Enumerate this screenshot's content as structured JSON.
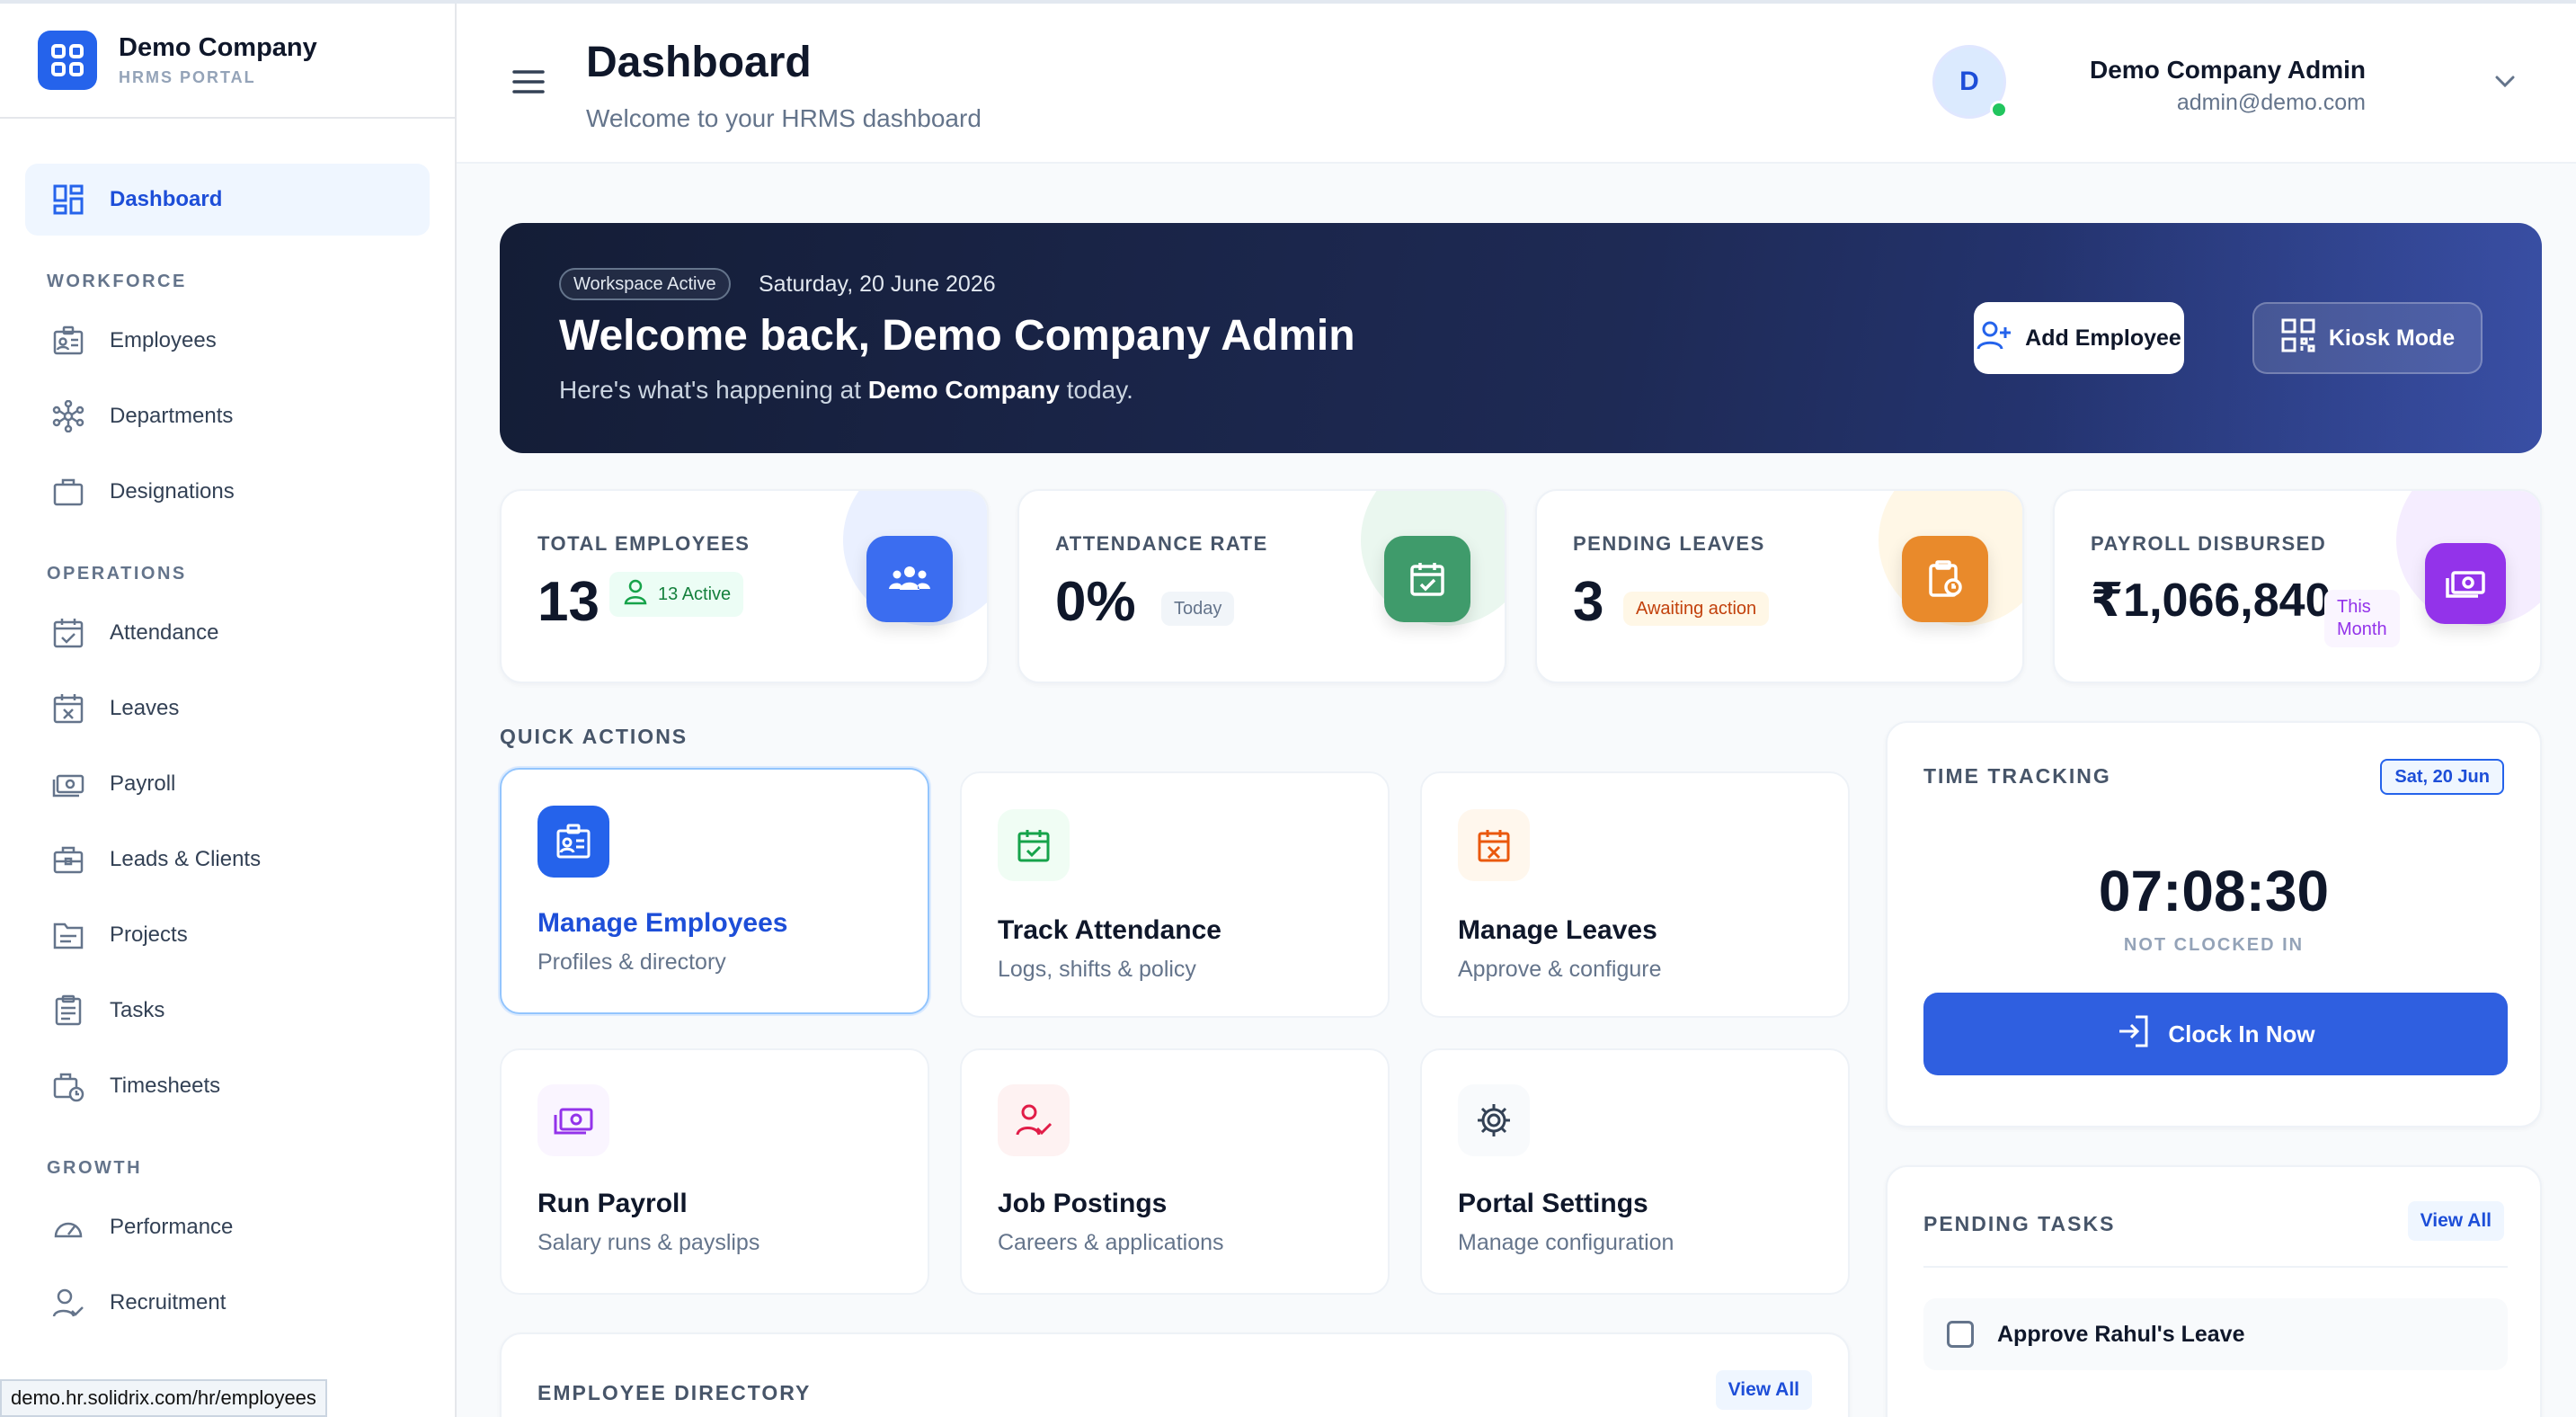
{
  "brand": {
    "name": "Demo Company",
    "subtitle": "HRMS PORTAL"
  },
  "sidebar": {
    "dashboard": "Dashboard",
    "sections": [
      {
        "title": "WORKFORCE",
        "items": [
          "Employees",
          "Departments",
          "Designations"
        ]
      },
      {
        "title": "OPERATIONS",
        "items": [
          "Attendance",
          "Leaves",
          "Payroll",
          "Leads & Clients",
          "Projects",
          "Tasks",
          "Timesheets"
        ]
      },
      {
        "title": "GROWTH",
        "items": [
          "Performance",
          "Recruitment"
        ]
      }
    ]
  },
  "status_bar_url": "demo.hr.solidrix.com/hr/employees",
  "header": {
    "title": "Dashboard",
    "subtitle": "Welcome to your HRMS dashboard",
    "user_name": "Demo Company Admin",
    "user_email": "admin@demo.com",
    "avatar_initial": "D"
  },
  "banner": {
    "badge": "Workspace Active",
    "date": "Saturday, 20 June 2026",
    "title": "Welcome back, Demo Company Admin",
    "sub_before": "Here's what's happening at ",
    "sub_company": "Demo Company",
    "sub_after": " today.",
    "add_button": "Add Employee",
    "kiosk_button": "Kiosk Mode"
  },
  "stats": [
    {
      "label": "TOTAL EMPLOYEES",
      "value": "13",
      "chip": "13 Active",
      "color": "#3b6df0"
    },
    {
      "label": "ATTENDANCE RATE",
      "value": "0%",
      "chip": "Today",
      "color": "#3f9b6b"
    },
    {
      "label": "PENDING LEAVES",
      "value": "3",
      "chip": "Awaiting action",
      "color": "#e98a2b"
    },
    {
      "label": "PAYROLL DISBURSED",
      "value": "₹1,066,840",
      "chip_line1": "This",
      "chip_line2": "Month",
      "color": "#9333ea"
    }
  ],
  "quick_actions": {
    "title": "QUICK ACTIONS",
    "items": [
      {
        "title": "Manage Employees",
        "sub": "Profiles & directory",
        "icon": "id-card-icon"
      },
      {
        "title": "Track Attendance",
        "sub": "Logs, shifts & policy",
        "icon": "calendar-check-icon"
      },
      {
        "title": "Manage Leaves",
        "sub": "Approve & configure",
        "icon": "calendar-x-icon"
      },
      {
        "title": "Run Payroll",
        "sub": "Salary runs & payslips",
        "icon": "money-icon"
      },
      {
        "title": "Job Postings",
        "sub": "Careers & applications",
        "icon": "user-check-icon"
      },
      {
        "title": "Portal Settings",
        "sub": "Manage configuration",
        "icon": "gear-icon"
      }
    ]
  },
  "directory": {
    "title": "EMPLOYEE DIRECTORY",
    "view_all": "View All"
  },
  "time_tracking": {
    "title": "TIME TRACKING",
    "date_pill": "Sat, 20 Jun",
    "clock": "07:08:30",
    "status": "NOT CLOCKED IN",
    "button": "Clock In Now"
  },
  "pending_tasks": {
    "title": "PENDING TASKS",
    "view_all": "View All",
    "items": [
      "Approve Rahul's Leave"
    ]
  }
}
